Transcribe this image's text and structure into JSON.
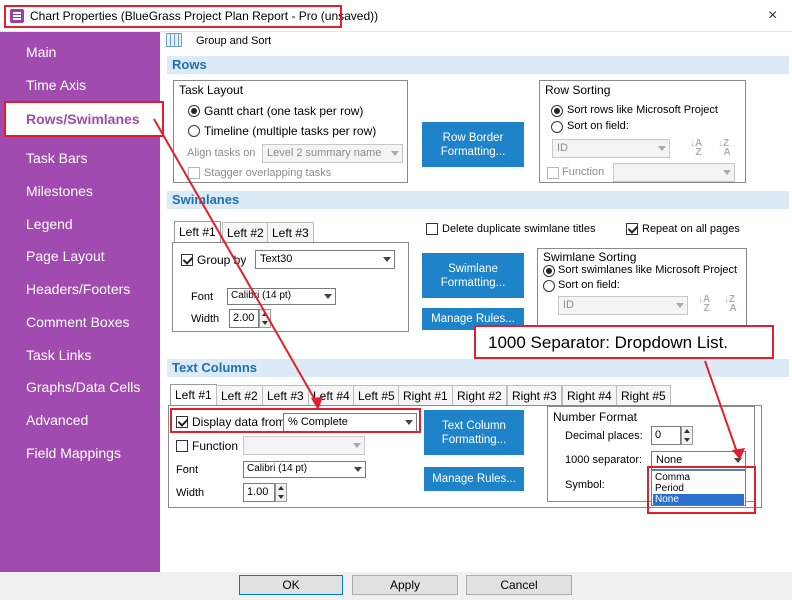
{
  "window": {
    "title": "Chart Properties (BlueGrass Project Plan Report - Pro (unsaved))",
    "close_glyph": "×"
  },
  "sidebar": {
    "items": [
      {
        "label": "Main"
      },
      {
        "label": "Time Axis"
      },
      {
        "label": "Rows/Swimlanes",
        "active": true
      },
      {
        "label": "Task Bars"
      },
      {
        "label": "Milestones"
      },
      {
        "label": "Legend"
      },
      {
        "label": "Page Layout"
      },
      {
        "label": "Headers/Footers"
      },
      {
        "label": "Comment Boxes"
      },
      {
        "label": "Task Links"
      },
      {
        "label": "Graphs/Data Cells"
      },
      {
        "label": "Advanced"
      },
      {
        "label": "Field Mappings"
      }
    ]
  },
  "toolbar": {
    "group_sort_label": "Group and Sort"
  },
  "rows": {
    "header": "Rows",
    "task_layout": {
      "title": "Task Layout",
      "gantt_label": "Gantt chart (one task per row)",
      "timeline_label": "Timeline (multiple tasks per row)",
      "align_label": "Align tasks on",
      "align_value": "Level 2 summary name",
      "stagger_label": "Stagger overlapping tasks"
    },
    "row_border_button": "Row Border Formatting...",
    "row_sorting": {
      "title": "Row Sorting",
      "like_project_label": "Sort rows like Microsoft Project",
      "sort_on_field_label": "Sort on field:",
      "field_value": "ID",
      "function_label": "Function",
      "function_value": ""
    }
  },
  "swimlanes": {
    "header": "Swimlanes",
    "tabs": [
      "Left #1",
      "Left #2",
      "Left #3"
    ],
    "delete_duplicate_label": "Delete duplicate swimlane titles",
    "repeat_label": "Repeat on all pages",
    "group_by_label": "Group by",
    "group_by_value": "Text30",
    "font_label": "Font",
    "font_value": "Calibri (14 pt)",
    "width_label": "Width",
    "width_value": "2.00",
    "swimlane_format_button": "Swimlane Formatting...",
    "manage_rules_button": "Manage Rules...",
    "sorting": {
      "title": "Swimlane Sorting",
      "like_project_label": "Sort swimlanes like Microsoft Project",
      "sort_on_field_label": "Sort on field:",
      "field_value": "ID"
    }
  },
  "text_columns": {
    "header": "Text Columns",
    "tabs": [
      "Left #1",
      "Left #2",
      "Left #3",
      "Left #4",
      "Left #5",
      "Right #1",
      "Right #2",
      "Right #3",
      "Right #4",
      "Right #5"
    ],
    "display_label": "Display data from",
    "display_value": "% Complete",
    "function_label": "Function",
    "function_value": "",
    "font_label": "Font",
    "font_value": "Calibri (14 pt)",
    "width_label": "Width",
    "width_value": "1.00",
    "text_column_format_button": "Text Column Formatting...",
    "manage_rules_button": "Manage Rules...",
    "number_format": {
      "title": "Number Format",
      "decimal_label": "Decimal places:",
      "decimal_value": "0",
      "separator_label": "1000 separator:",
      "separator_value": "None",
      "symbol_label": "Symbol:",
      "separator_options": [
        "Comma",
        "Period",
        "None"
      ]
    }
  },
  "annotation": {
    "callout_text": "1000 Separator: Dropdown List."
  },
  "footer": {
    "ok": "OK",
    "apply": "Apply",
    "cancel": "Cancel"
  },
  "colors": {
    "sidebar": "#a14ab0",
    "accent_blue": "#1e83c9",
    "highlight_red": "#e0202a",
    "section_bg": "#dce9f6"
  }
}
